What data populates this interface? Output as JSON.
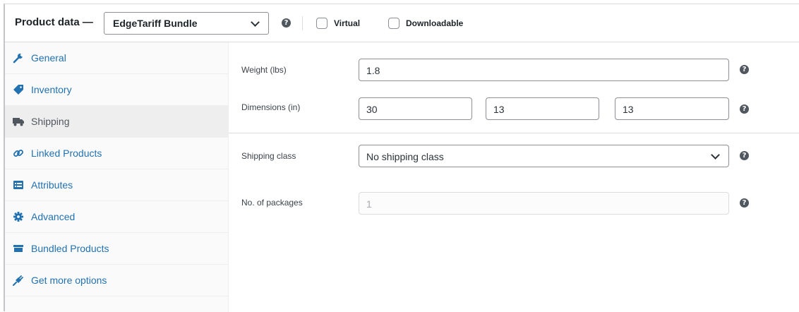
{
  "header": {
    "title": "Product data —",
    "product_type": "EdgeTariff Bundle",
    "virtual_label": "Virtual",
    "downloadable_label": "Downloadable",
    "help_glyph": "?"
  },
  "sidebar": {
    "items": [
      {
        "label": "General",
        "icon": "wrench-icon"
      },
      {
        "label": "Inventory",
        "icon": "tag-icon"
      },
      {
        "label": "Shipping",
        "icon": "truck-icon"
      },
      {
        "label": "Linked Products",
        "icon": "link-icon"
      },
      {
        "label": "Attributes",
        "icon": "list-icon"
      },
      {
        "label": "Advanced",
        "icon": "gear-icon"
      },
      {
        "label": "Bundled Products",
        "icon": "archive-icon"
      },
      {
        "label": "Get more options",
        "icon": "plugin-icon"
      }
    ],
    "active": "Shipping"
  },
  "shipping": {
    "weight_label": "Weight (lbs)",
    "weight_value": "1.8",
    "dimensions_label": "Dimensions (in)",
    "length": "30",
    "width": "13",
    "height": "13",
    "shipping_class_label": "Shipping class",
    "shipping_class_value": "No shipping class",
    "packages_label": "No. of packages",
    "packages_value": "1"
  },
  "colors": {
    "link": "#2271b1",
    "active_tab_bg": "#eeeeee",
    "border": "#8c8f94"
  }
}
